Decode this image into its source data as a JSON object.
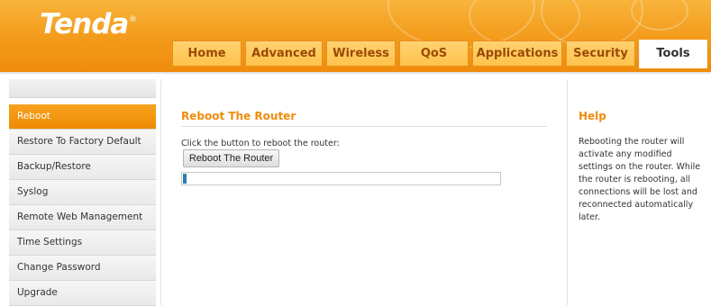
{
  "brand": {
    "logo_text": "Tenda",
    "registered_mark": "®"
  },
  "tabs": [
    {
      "label": "Home"
    },
    {
      "label": "Advanced"
    },
    {
      "label": "Wireless"
    },
    {
      "label": "QoS"
    },
    {
      "label": "Applications"
    },
    {
      "label": "Security"
    },
    {
      "label": "Tools"
    }
  ],
  "active_tab": "Tools",
  "sidebar": {
    "items": [
      {
        "label": "Reboot"
      },
      {
        "label": "Restore To Factory Default"
      },
      {
        "label": "Backup/Restore"
      },
      {
        "label": "Syslog"
      },
      {
        "label": "Remote Web Management"
      },
      {
        "label": "Time Settings"
      },
      {
        "label": "Change Password"
      },
      {
        "label": "Upgrade"
      }
    ],
    "active_item": "Reboot"
  },
  "main": {
    "title": "Reboot The Router",
    "description": "Click the button to reboot the router:",
    "button_label": "Reboot The Router",
    "progress_fraction": 0.01
  },
  "help": {
    "title": "Help",
    "text": "Rebooting the router will activate any modified settings on the router. While the router is rebooting, all connections will be lost and reconnected automatically later."
  },
  "colors": {
    "brand_orange": "#f39a1a",
    "accent_orange": "#f08c0c",
    "progress_blue": "#2a7fae"
  }
}
